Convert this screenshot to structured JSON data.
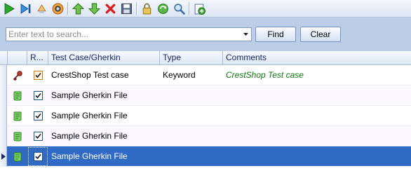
{
  "toolbar": {
    "buttons": [
      {
        "icon": "play-icon"
      },
      {
        "icon": "step-into-icon"
      },
      {
        "icon": "sweep-icon"
      },
      {
        "icon": "record-icon"
      },
      {
        "icon": "move-up-icon"
      },
      {
        "icon": "move-down-icon"
      },
      {
        "icon": "delete-icon"
      },
      {
        "icon": "save-icon"
      },
      {
        "icon": "lock-icon"
      },
      {
        "icon": "refresh-icon"
      },
      {
        "icon": "find-icon"
      },
      {
        "icon": "add-icon"
      }
    ]
  },
  "search": {
    "placeholder": "Enter text to search...",
    "value": "",
    "find_label": "Find",
    "clear_label": "Clear"
  },
  "grid": {
    "columns": {
      "run": "R...",
      "name": "Test Case/Gherkin",
      "type": "Type",
      "comments": "Comments"
    },
    "rows": [
      {
        "icon": "test-case-key-icon",
        "checked": true,
        "name": "CrestShop Test case",
        "type": "Keyword",
        "comments": "CrestShop Test case"
      },
      {
        "icon": "gherkin-file-icon",
        "checked": true,
        "name": "Sample Gherkin File",
        "type": "",
        "comments": ""
      },
      {
        "icon": "gherkin-file-icon",
        "checked": true,
        "name": "Sample Gherkin File",
        "type": "",
        "comments": ""
      },
      {
        "icon": "gherkin-file-icon",
        "checked": true,
        "name": "Sample Gherkin File",
        "type": "",
        "comments": ""
      },
      {
        "icon": "gherkin-file-icon",
        "checked": true,
        "name": "Sample Gherkin File",
        "type": "",
        "comments": "",
        "selected": true
      }
    ]
  },
  "colors": {
    "selection": "#316ac5",
    "comment": "#107c10",
    "panel": "#bccde7"
  }
}
